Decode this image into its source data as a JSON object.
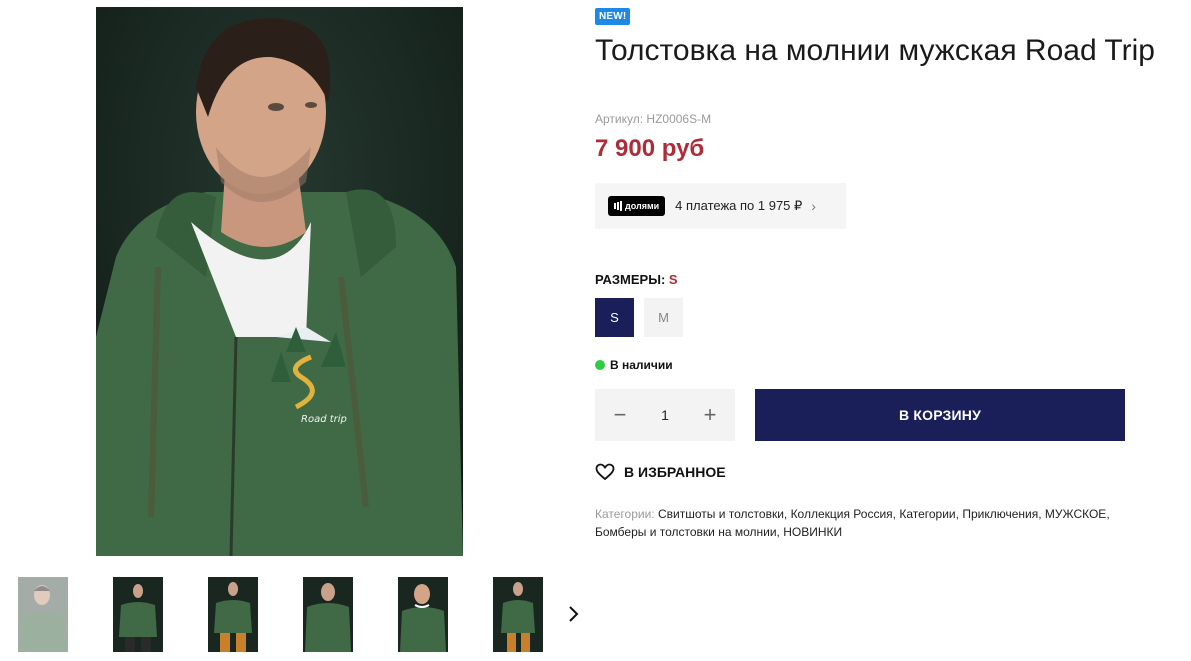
{
  "badge": "NEW!",
  "product": {
    "title": "Толстовка на молнии мужская Road Trip",
    "sku": "Артикул: HZ0006S-M",
    "price": "7 900 руб"
  },
  "dolyami": {
    "logo_text": "долями",
    "text": "4 платежа по 1 975 ₽"
  },
  "sizes": {
    "label": "РАЗМЕРЫ:",
    "selected": "S",
    "options": [
      "S",
      "M"
    ]
  },
  "stock": "В наличии",
  "quantity": {
    "value": "1",
    "minus": "−",
    "plus": "+"
  },
  "cart_button": "В КОРЗИНУ",
  "favorite_label": "В ИЗБРАННОЕ",
  "categories": {
    "label": "Категории:",
    "items": [
      "Свитшоты и толстовки",
      "Коллекция Россия",
      "Категории",
      "Приключения",
      "МУЖСКОЕ",
      "Бомберы и толстовки на молнии",
      "НОВИНКИ"
    ]
  },
  "embroidery_text": "Road trip",
  "icons": {
    "heart": "heart-icon",
    "chevron": "chevron-right-icon",
    "stock_dot": "green-dot"
  },
  "colors": {
    "accent": "#1a1f5a",
    "price": "#b02a37",
    "badge": "#1e88e5",
    "stock": "#2ecc40",
    "hoodie": "#3f6a45"
  }
}
